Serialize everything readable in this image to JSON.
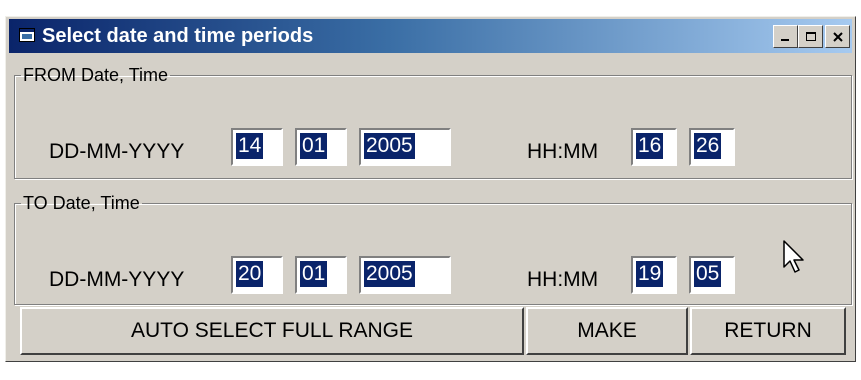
{
  "window": {
    "title": "Select date and time periods",
    "controls": {
      "minimize_icon": "minimize-icon",
      "maximize_icon": "maximize-icon",
      "close_icon": "close-icon"
    }
  },
  "from": {
    "legend": "FROM Date, Time",
    "date_label": "DD-MM-YYYY",
    "day": "14",
    "month": "01",
    "year": "2005",
    "time_label": "HH:MM",
    "hour": "16",
    "minute": "26"
  },
  "to": {
    "legend": "TO Date, Time",
    "date_label": "DD-MM-YYYY",
    "day": "20",
    "month": "01",
    "year": "2005",
    "time_label": "HH:MM",
    "hour": "19",
    "minute": "05"
  },
  "buttons": {
    "auto_select": "AUTO SELECT FULL RANGE",
    "make": "MAKE",
    "return": "RETURN"
  },
  "colors": {
    "titlebar_start": "#0a246a",
    "titlebar_end": "#a6caf0",
    "selection": "#0a246a",
    "face": "#d4d0c8"
  }
}
